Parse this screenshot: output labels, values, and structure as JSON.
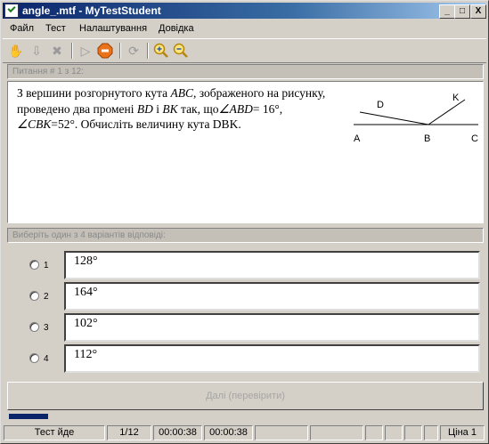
{
  "window": {
    "title": "angle_.mtf - MyTestStudent",
    "controls": {
      "minimize": "_",
      "maximize": "□",
      "close": "X"
    }
  },
  "menu": {
    "items": [
      "Файл",
      "Тест",
      "Налаштування",
      "Довідка"
    ]
  },
  "toolbar": {
    "icons": [
      "hand-icon",
      "down-arrow-icon",
      "delete-icon",
      "play-icon",
      "stop-icon",
      "refresh-icon",
      "zoom-in-icon",
      "zoom-out-icon"
    ],
    "colors": {
      "zoom": "#d4a017",
      "stop": "#e8731a"
    }
  },
  "question": {
    "header": "Питання # 1 з 12:",
    "text_parts": [
      "З вершини розгорнутого кута ",
      "ABC",
      ", зображеного на рисунку, проведено два промені ",
      "BD",
      " і ",
      "BK",
      " так, що",
      "∠ABD",
      "= 16",
      "°",
      ", ",
      "∠CBK",
      "=52°. Обчисліть величину кута DBK."
    ],
    "figure": {
      "labels": {
        "A": "A",
        "B": "B",
        "C": "C",
        "D": "D",
        "K": "K"
      }
    }
  },
  "answers": {
    "header": "Виберіть один з 4 варіантів відповіді:",
    "options": [
      {
        "num": "1",
        "value": "128°"
      },
      {
        "num": "2",
        "value": "164°"
      },
      {
        "num": "3",
        "value": "102°"
      },
      {
        "num": "4",
        "value": "112°"
      }
    ]
  },
  "next_button": "Далі (перевірити)",
  "progress": {
    "fraction": 0.083,
    "color": "#0a246a"
  },
  "status": {
    "state": "Тест йде",
    "counter": "1/12",
    "time_elapsed": "00:00:38",
    "time_total": "00:00:38",
    "price": "Ціна 1"
  }
}
